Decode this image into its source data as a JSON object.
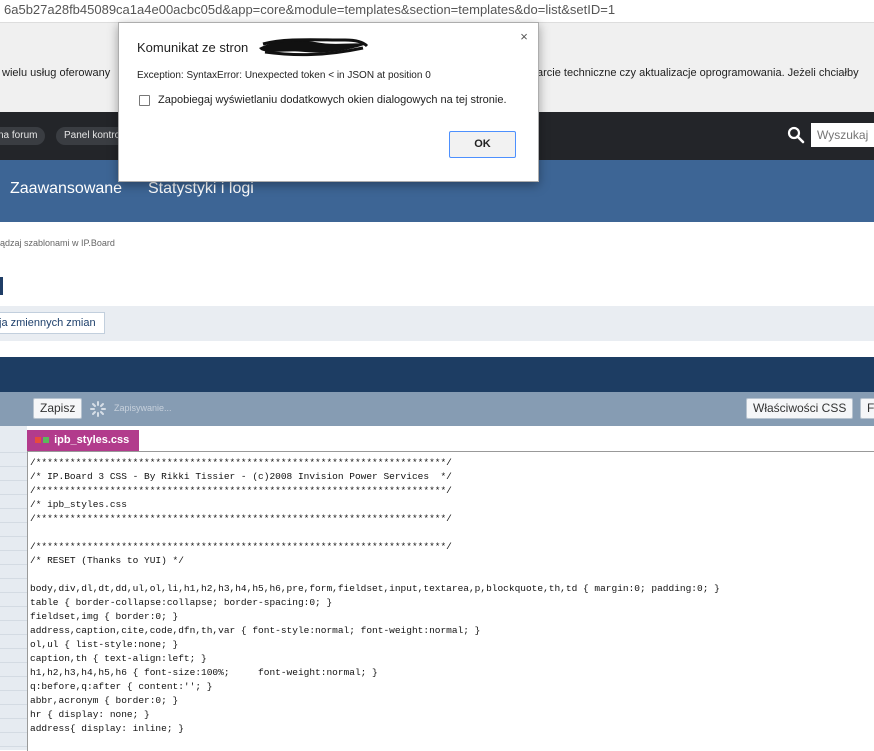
{
  "browser": {
    "url_fragment": "6a5b27a28fb45089ca1a4e00acbc05d&app=core&module=templates&section=templates&do=list&setID=1"
  },
  "notice": {
    "left_text": "wielu usług oferowany",
    "right_text": "arcie techniczne czy aktualizacje oprogramowania. Jeżeli chciałby"
  },
  "topnav": {
    "items": [
      "na forum",
      "Panel kontro"
    ],
    "search_placeholder": "Wyszukaj"
  },
  "mainnav": {
    "tabs": [
      "Zaawansowane",
      "Statystyki i logi"
    ]
  },
  "breadcrumb": "ądzaj szablonami w IP.Board",
  "subbar": {
    "button_label": "ja zmiennych zmian"
  },
  "toolbar": {
    "save_label": "Zapisz",
    "saving_text": "Zapisywanie...",
    "css_props_label": "Właściwości CSS",
    "cut_label": "F"
  },
  "editor": {
    "file_tab": "ipb_styles.css",
    "lines": [
      "/************************************************************************/",
      "/* IP.Board 3 CSS - By Rikki Tissier - (c)2008 Invision Power Services  */",
      "/************************************************************************/",
      "/* ipb_styles.css                                                        ",
      "/************************************************************************/",
      "",
      "/************************************************************************/",
      "/* RESET (Thanks to YUI) */",
      "",
      "body,div,dl,dt,dd,ul,ol,li,h1,h2,h3,h4,h5,h6,pre,form,fieldset,input,textarea,p,blockquote,th,td { margin:0; padding:0; }",
      "table { border-collapse:collapse; border-spacing:0; }",
      "fieldset,img { border:0; }",
      "address,caption,cite,code,dfn,th,var { font-style:normal; font-weight:normal; }",
      "ol,ul { list-style:none; }",
      "caption,th { text-align:left; }",
      "h1,h2,h3,h4,h5,h6 { font-size:100%;     font-weight:normal; }",
      "q:before,q:after { content:''; }",
      "abbr,acronym { border:0; }",
      "hr { display: none; }",
      "address{ display: inline; }"
    ]
  },
  "dialog": {
    "title": "Komunikat ze stron",
    "close_glyph": "×",
    "message": "Exception: SyntaxError: Unexpected token < in JSON at position 0",
    "checkbox_label": "Zapobiegaj wyświetlaniu dodatkowych okien dialogowych na tej stronie.",
    "ok_label": "OK"
  },
  "icons": {
    "search": "search-icon",
    "saving": "spinner-icon",
    "close": "close-icon"
  }
}
